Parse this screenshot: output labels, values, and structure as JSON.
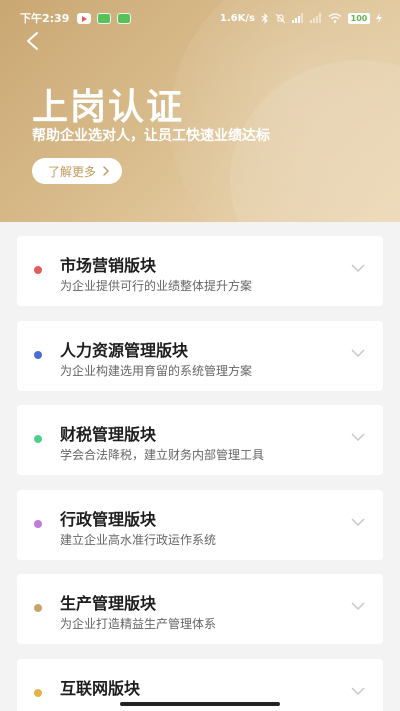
{
  "status_bar": {
    "time": "下午2:39",
    "net_speed": "1.6K/s",
    "battery": "100"
  },
  "header": {
    "title": "上岗认证",
    "subtitle": "帮助企业选对人，让员工快速业绩达标",
    "more_label": "了解更多"
  },
  "colors": {
    "hero_gold": "#d6b584",
    "more_text": "#c49a5b"
  },
  "modules": [
    {
      "title": "市场营销版块",
      "desc": "为企业提供可行的业绩整体提升方案",
      "dot_color": "#e35c5c"
    },
    {
      "title": "人力资源管理版块",
      "desc": "为企业构建选用育留的系统管理方案",
      "dot_color": "#4a6cd6"
    },
    {
      "title": "财税管理版块",
      "desc": "学会合法降税，建立财务内部管理工具",
      "dot_color": "#4fcf8d"
    },
    {
      "title": "行政管理版块",
      "desc": "建立企业高水准行政运作系统",
      "dot_color": "#c07ad8"
    },
    {
      "title": "生产管理版块",
      "desc": "为企业打造精益生产管理体系",
      "dot_color": "#c9a46a"
    },
    {
      "title": "互联网版块",
      "desc": "",
      "dot_color": "#e6b34a"
    }
  ]
}
